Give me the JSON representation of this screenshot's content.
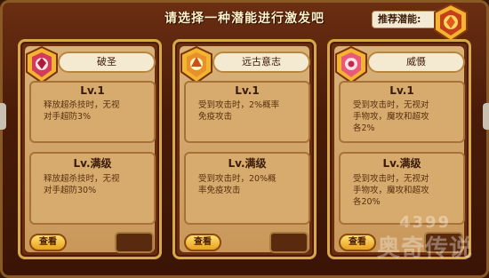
{
  "header": {
    "title": "请选择一种潜能进行激发吧",
    "recommend_label": "推荐潜能:"
  },
  "cards": [
    {
      "name": "破圣",
      "lv1_title": "Lv.1",
      "lv1_desc": "释放超杀技时，无视\n对手超防3%",
      "max_title": "Lv.满级",
      "max_desc": "释放超杀技时，无视\n对手超防30%",
      "view_label": "查看",
      "medal_color": "#d43a5a"
    },
    {
      "name": "远古意志",
      "lv1_title": "Lv.1",
      "lv1_desc": "受到攻击时，2%概率\n免疫攻击",
      "max_title": "Lv.满级",
      "max_desc": "受到攻击时，20%概\n率免疫攻击",
      "view_label": "查看",
      "medal_color": "#e8902a"
    },
    {
      "name": "威慑",
      "lv1_title": "Lv.1",
      "lv1_desc": "受到攻击时，无视对\n手物攻，魔攻和超攻\n各2%",
      "max_title": "Lv.满级",
      "max_desc": "受到攻击时，无视对\n手物攻，魔攻和超攻\n各20%",
      "view_label": "查看",
      "medal_color": "#e85a7a"
    }
  ],
  "watermark": {
    "top": "4399",
    "bottom": "奥奇传说"
  }
}
